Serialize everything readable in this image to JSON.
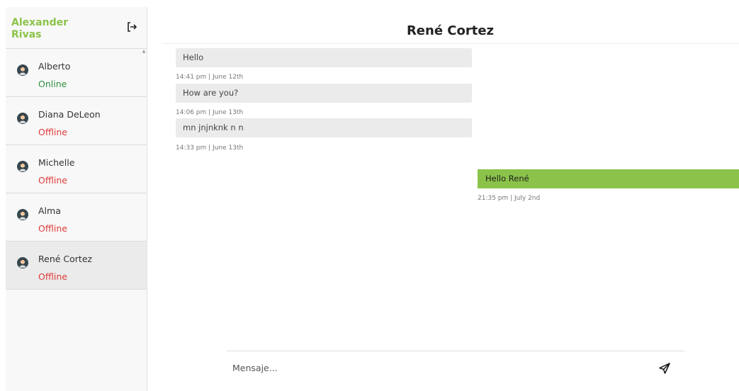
{
  "user": {
    "name": "Alexander Rivas"
  },
  "icons": {
    "logout": "logout-icon",
    "avatar": "user-avatar-icon",
    "send": "send-icon"
  },
  "contacts": [
    {
      "name": "Alberto",
      "status": "Online"
    },
    {
      "name": "Diana DeLeon",
      "status": "Offline"
    },
    {
      "name": "Michelle",
      "status": "Offline"
    },
    {
      "name": "Alma",
      "status": "Offline"
    },
    {
      "name": "René Cortez",
      "status": "Offline"
    }
  ],
  "chat": {
    "title": "René Cortez",
    "messages": [
      {
        "text": "Hello",
        "time": "14:41 pm | June 12th"
      },
      {
        "text": "How are you?",
        "time": "14:06 pm | June 13th"
      },
      {
        "text": "mn jnjnknk n n",
        "time": "14:33 pm | June 13th"
      },
      {
        "text": "Hello René",
        "time": "21:35 pm | July 2nd"
      }
    ]
  },
  "composer": {
    "placeholder": "Mensaje..."
  },
  "colors": {
    "accent": "#8bc34a",
    "online": "#2f8f3f",
    "offline": "#e03a3a"
  }
}
